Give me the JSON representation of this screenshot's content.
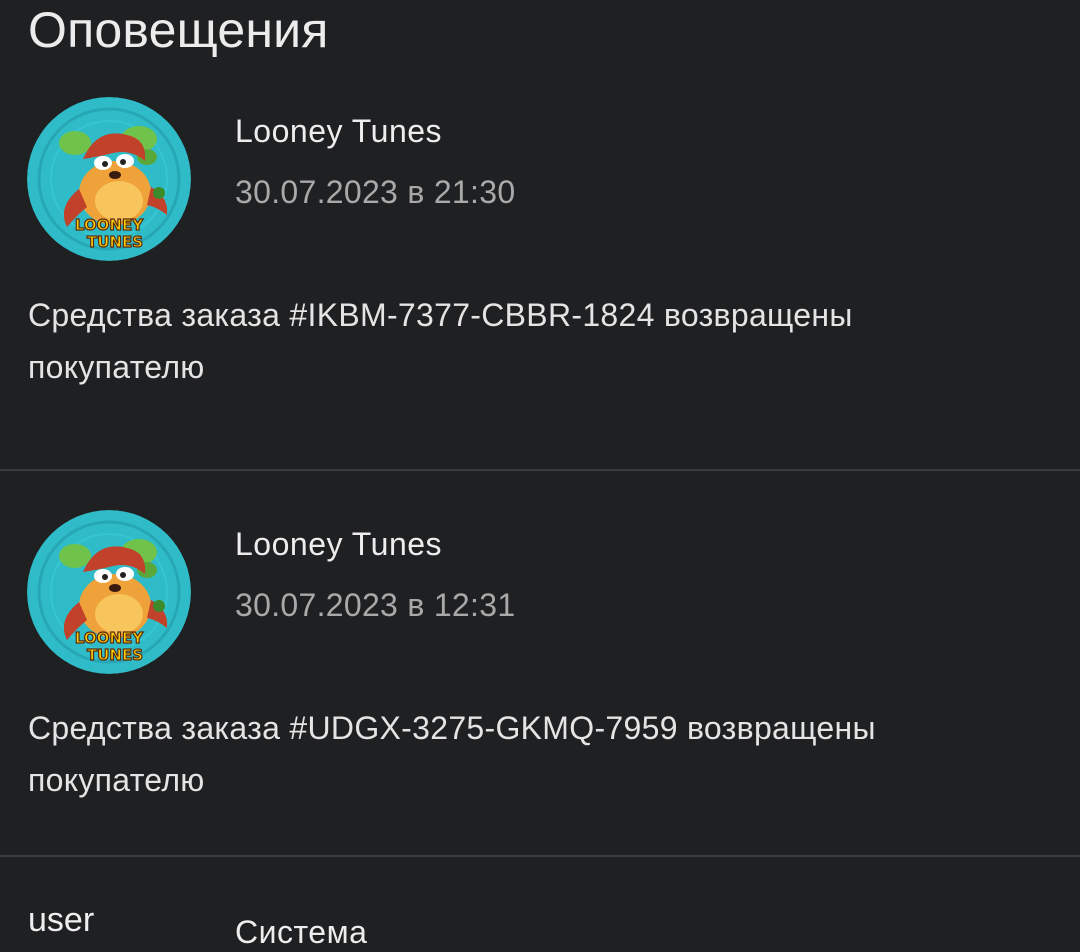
{
  "header": {
    "title": "Оповещения"
  },
  "notifications": [
    {
      "avatar": "looney-tunes-taz-avatar",
      "avatar_text": [
        "LOONEY",
        "TUNES"
      ],
      "sender": "Looney Tunes",
      "time": "30.07.2023 в 21:30",
      "message": "Средства заказа #IKBM-7377-CBBR-1824 возвращены покупателю"
    },
    {
      "avatar": "looney-tunes-taz-avatar",
      "avatar_text": [
        "LOONEY",
        "TUNES"
      ],
      "sender": "Looney Tunes",
      "time": "30.07.2023 в 12:31",
      "message": "Средства заказа #UDGX-3275-GKMQ-7959 возвращены покупателю"
    },
    {
      "avatar_label": "user",
      "sender": "Система"
    }
  ],
  "colors": {
    "background": "#1f2022",
    "divider": "#3a3b3e",
    "avatar_bg": "#2fbcc8",
    "secondary_text": "#a9a9a9"
  }
}
